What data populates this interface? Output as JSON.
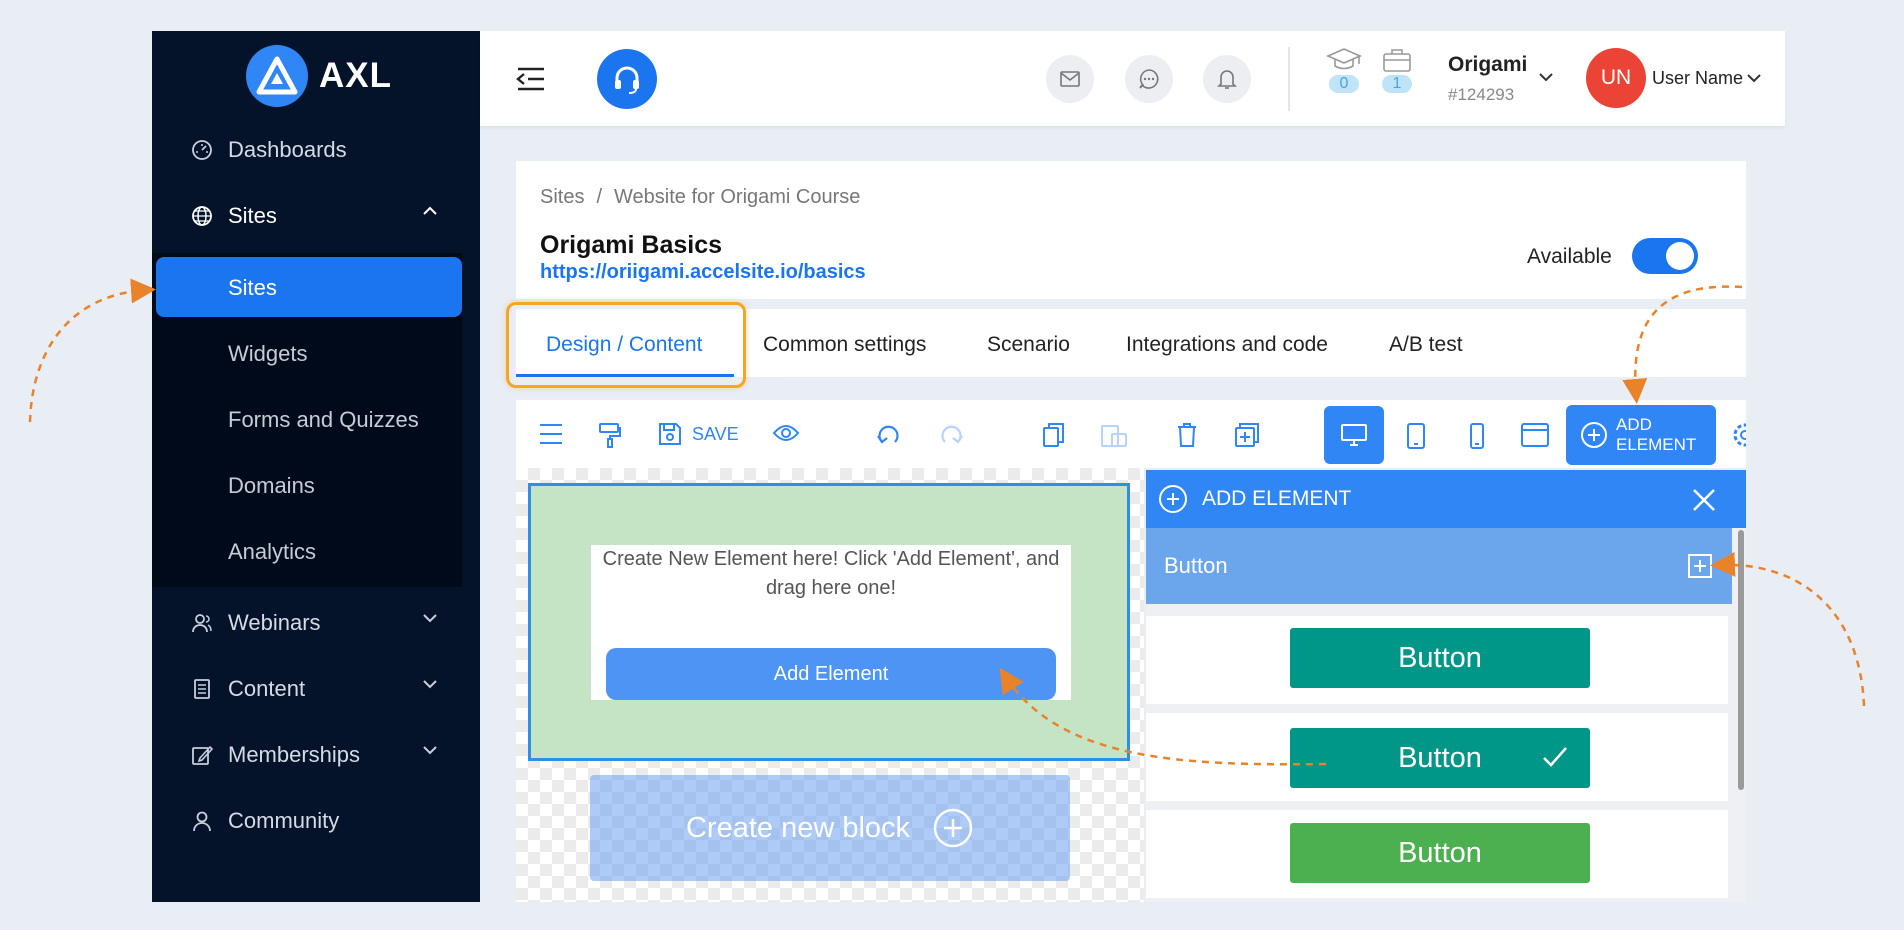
{
  "app": {
    "logo_text": "AXL"
  },
  "sidebar": {
    "items": [
      {
        "label": "Dashboards",
        "icon": "gauge-icon"
      },
      {
        "label": "Sites",
        "icon": "globe-icon"
      },
      {
        "label": "Webinars",
        "icon": "users-icon"
      },
      {
        "label": "Content",
        "icon": "document-icon"
      },
      {
        "label": "Memberships",
        "icon": "edit-icon"
      },
      {
        "label": "Community",
        "icon": "user-icon"
      }
    ],
    "sub_items": [
      "Sites",
      "Widgets",
      "Forms and Quizzes",
      "Domains",
      "Analytics"
    ]
  },
  "topbar": {
    "course_count": "0",
    "product_count": "1",
    "account_name": "Origami",
    "account_id": "#124293",
    "avatar_initials": "UN",
    "user_name": "User Name"
  },
  "page": {
    "breadcrumb": [
      "Sites",
      "Website for Origami Course"
    ],
    "breadcrumb_sep": "/",
    "title": "Origami Basics",
    "url": "https://oriigami.accelsite.io/basics",
    "availability_label": "Available",
    "available": true
  },
  "tabs": [
    "Design / Content",
    "Common settings",
    "Scenario",
    "Integrations and code",
    "A/B test"
  ],
  "active_tab": "Design / Content",
  "toolbar": {
    "save_label": "SAVE",
    "add_element_label_1": "ADD",
    "add_element_label_2": "ELEMENT"
  },
  "canvas": {
    "hint_text": "Create New Element here! Click 'Add Element', and drag here one!",
    "add_element_button": "Add Element",
    "create_block_label": "Create new block"
  },
  "panel": {
    "title": "ADD ELEMENT",
    "category": "Button",
    "samples": [
      {
        "label": "Button",
        "color": "#009688",
        "checked": false
      },
      {
        "label": "Button",
        "color": "#009688",
        "checked": true
      },
      {
        "label": "Button",
        "color": "#4caf50",
        "checked": false
      }
    ]
  },
  "colors": {
    "sidebar_bg": "#04122a",
    "accent": "#1a75ee",
    "highlight_border": "#f5a623",
    "annotation_arrow": "#e8832a"
  }
}
